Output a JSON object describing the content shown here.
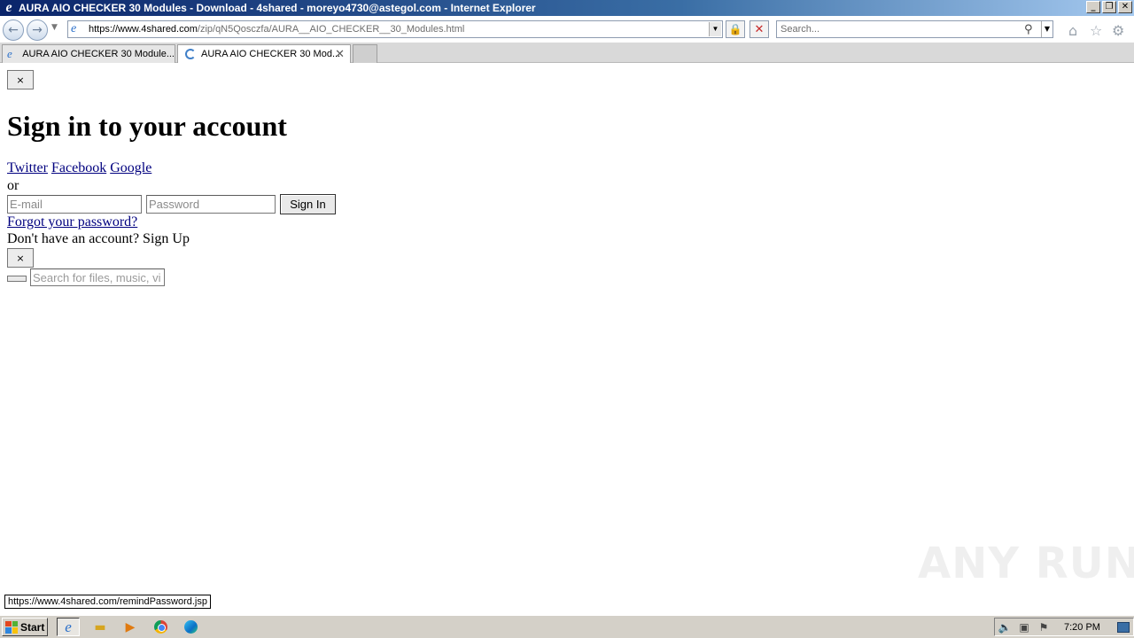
{
  "window": {
    "title": "AURA AIO CHECKER 30 Modules - Download - 4shared - moreyo4730@astegol.com - Internet Explorer",
    "controls": {
      "minimize": "_",
      "restore": "❐",
      "close": "✕"
    }
  },
  "addressbar": {
    "scheme_host": "https://www.4shared.com",
    "path": "/zip/qN5Qosczfa/AURA__AIO_CHECKER__30_Modules.html",
    "search_placeholder": "Search..."
  },
  "tabs": [
    {
      "label": "AURA AIO CHECKER 30 Module...",
      "active": false
    },
    {
      "label": "AURA AIO CHECKER 30 Mod...",
      "active": true,
      "loading": true
    }
  ],
  "page": {
    "close_top": "×",
    "heading": "Sign in to your account",
    "social": [
      "Twitter",
      "Facebook",
      "Google"
    ],
    "or": "or",
    "email_placeholder": "E-mail",
    "password_placeholder": "Password",
    "signin_label": "Sign In",
    "forgot_link": "Forgot your password?",
    "signup_text": "Don't have an account? Sign Up",
    "close_bottom": "×",
    "search_placeholder": "Search for files, music, vi",
    "watermark": "ANY RUN"
  },
  "status": {
    "hover_url": "https://www.4shared.com/remindPassword.jsp"
  },
  "taskbar": {
    "start_label": "Start",
    "clock": "7:20 PM"
  },
  "colors": {
    "link": "#00007f",
    "titlebar_start": "#0a246a",
    "taskbar_bg": "#d4d0c8"
  }
}
